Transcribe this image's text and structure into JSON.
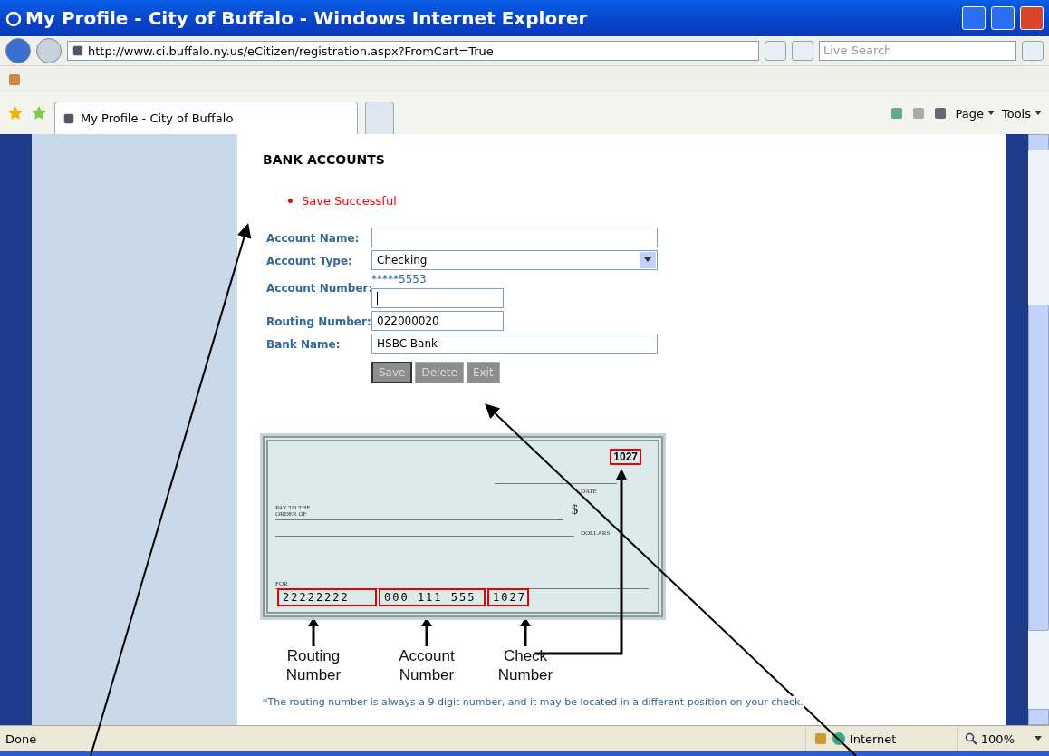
{
  "window": {
    "title": "My Profile - City of Buffalo - Windows Internet Explorer"
  },
  "address_bar": {
    "url": "http://www.ci.buffalo.ny.us/eCitizen/registration.aspx?FromCart=True",
    "search_placeholder": "Live Search"
  },
  "tabs": [
    {
      "label": "My Profile - City of Buffalo",
      "selected": true
    }
  ],
  "command_bar": [
    "Page",
    "Tools"
  ],
  "page": {
    "heading": "BANK ACCOUNTS",
    "messages": [
      "Save Successful"
    ],
    "fields": [
      {
        "kind": "input",
        "wide": true,
        "label": "Account Name:"
      },
      {
        "kind": "select",
        "wide": true,
        "label": "Account Type:",
        "value": "Checking"
      },
      {
        "kind": "masked",
        "wide": false,
        "label": "Account Number:",
        "masked": "*****5553"
      },
      {
        "kind": "input",
        "wide": false,
        "label": "Routing Number:",
        "value": "022000020"
      },
      {
        "kind": "input",
        "wide": true,
        "label": "Bank Name:",
        "value": "HSBC Bank"
      }
    ],
    "buttons": [
      {
        "label": "Save",
        "focused": true
      },
      {
        "label": "Delete",
        "focused": false
      },
      {
        "label": "Exit",
        "focused": false
      }
    ],
    "check": {
      "number": "1027",
      "date_label": "DATE",
      "payee_label": "PAY TO THE ORDER OF",
      "currency": "$",
      "dollars_label": "DOLLARS",
      "memo_label": "FOR",
      "micr": [
        {
          "text": "22222222"
        },
        {
          "text": "000 111 555"
        },
        {
          "text": "1027"
        }
      ],
      "captions": [
        "Routing Number",
        "Account Number",
        "Check Number"
      ]
    },
    "footnote": "*The routing number is always a 9 digit number, and it may be located in a different position on your check."
  },
  "status_bar": {
    "text": "Done",
    "zone": "Internet",
    "zoom": "100%"
  }
}
